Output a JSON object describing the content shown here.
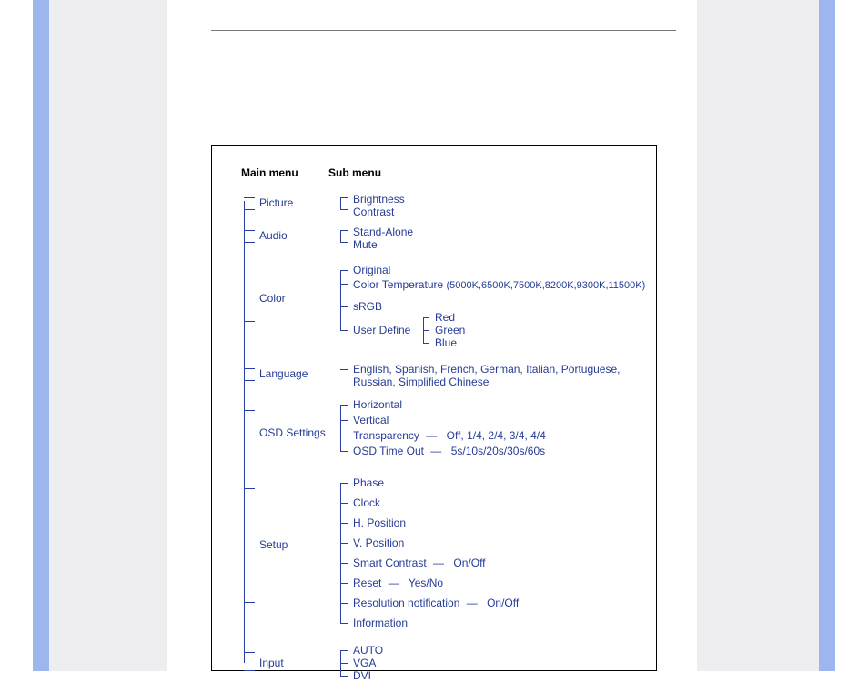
{
  "headers": {
    "main": "Main menu",
    "sub": "Sub menu"
  },
  "menu": {
    "picture": {
      "label": "Picture",
      "items": {
        "brightness": "Brightness",
        "contrast": "Contrast"
      }
    },
    "audio": {
      "label": "Audio",
      "items": {
        "standalone": "Stand-Alone",
        "mute": "Mute"
      }
    },
    "color": {
      "label": "Color",
      "items": {
        "original": "Original",
        "colortemp": "Color Temperature",
        "colortemp_vals": "(5000K,6500K,7500K,8200K,9300K,11500K)",
        "srgb": "sRGB",
        "userdefine": "User Define",
        "ud": {
          "red": "Red",
          "green": "Green",
          "blue": "Blue"
        }
      }
    },
    "language": {
      "label": "Language",
      "line1": "English, Spanish, French, German, Italian, Portuguese,",
      "line2": "Russian, Simplified Chinese"
    },
    "osd": {
      "label": "OSD Settings",
      "items": {
        "horiz": "Horizontal",
        "vert": "Vertical",
        "transp": "Transparency",
        "transp_vals": "Off, 1/4, 2/4, 3/4, 4/4",
        "timeout": "OSD Time Out",
        "timeout_vals": "5s/10s/20s/30s/60s"
      }
    },
    "setup": {
      "label": "Setup",
      "items": {
        "phase": "Phase",
        "clock": "Clock",
        "hpos": "H. Position",
        "vpos": "V. Position",
        "smart": "Smart Contrast",
        "smart_vals": "On/Off",
        "reset": "Reset",
        "reset_vals": "Yes/No",
        "resnot": "Resolution notification",
        "resnot_vals": "On/Off",
        "info": "Information"
      }
    },
    "input": {
      "label": "Input",
      "items": {
        "auto": "AUTO",
        "vga": "VGA",
        "dvi": "DVI"
      }
    }
  }
}
